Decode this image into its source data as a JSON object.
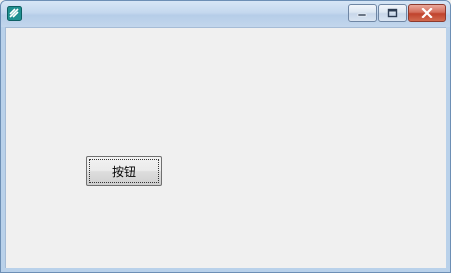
{
  "window": {
    "title": "",
    "icon": "app-icon",
    "controls": {
      "minimize_icon": "minimize-icon",
      "maximize_icon": "maximize-icon",
      "close_icon": "close-icon"
    },
    "colors": {
      "close_button": "#c0432d",
      "client_background": "#f0f0f0",
      "frame": "#b9d1ea"
    }
  },
  "content": {
    "button_label": "按钮"
  }
}
